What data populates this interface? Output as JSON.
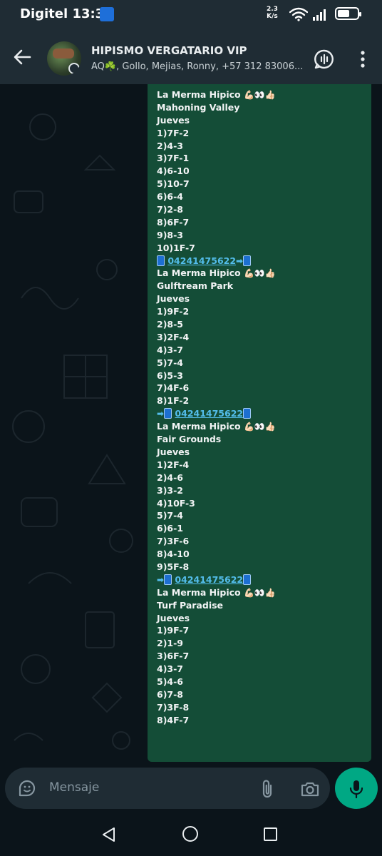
{
  "status_bar": {
    "carrier": "Digitel",
    "time": "13:36",
    "net_speed_value": "2.3",
    "net_speed_unit": "K/s",
    "battery_level": 0.6
  },
  "header": {
    "title": "HIPISMO VERGATARIO VIP",
    "subtitle": "AQ☘️, Gollo, Mejias, Ronny, +57 312 83006..."
  },
  "message": {
    "lines": [
      {
        "text": "La Merma Hipico ",
        "emoji": "💪🏻👀👍🏻"
      },
      {
        "text": "Mahoning Valley"
      },
      {
        "text": "Jueves"
      },
      {
        "text": "1)7F-2"
      },
      {
        "text": "2)4-3"
      },
      {
        "text": "3)7F-1"
      },
      {
        "text": "4)6-10"
      },
      {
        "text": "5)10-7"
      },
      {
        "text": "6)6-4"
      },
      {
        "text": "7)2-8"
      },
      {
        "text": "8)6F-7"
      },
      {
        "text": "9)8-3"
      },
      {
        "text": "10)1F-7"
      },
      {
        "phone": "04241475622",
        "prefix_arrow": "",
        "suffix_arrow": "➡"
      },
      {
        "text": "La Merma Hipico ",
        "emoji": "💪🏻👀👍🏻"
      },
      {
        "text": "Gulftream Park"
      },
      {
        "text": "Jueves"
      },
      {
        "text": "1)9F-2"
      },
      {
        "text": "2)8-5"
      },
      {
        "text": "3)2F-4"
      },
      {
        "text": "4)3-7"
      },
      {
        "text": "5)7-4"
      },
      {
        "text": "6)5-3"
      },
      {
        "text": "7)4F-6"
      },
      {
        "text": "8)1F-2"
      },
      {
        "phone": "04241475622",
        "prefix_arrow": "➡",
        "suffix_arrow": ""
      },
      {
        "text": "La Merma Hipico ",
        "emoji": "💪🏻👀👍🏻"
      },
      {
        "text": "Fair Grounds"
      },
      {
        "text": "Jueves"
      },
      {
        "text": "1)2F-4"
      },
      {
        "text": "2)4-6"
      },
      {
        "text": "3)3-2"
      },
      {
        "text": "4)10F-3"
      },
      {
        "text": "5)7-4"
      },
      {
        "text": "6)6-1"
      },
      {
        "text": "7)3F-6"
      },
      {
        "text": "8)4-10"
      },
      {
        "text": "9)5F-8"
      },
      {
        "phone": "04241475622",
        "prefix_arrow": "➡",
        "suffix_arrow": ""
      },
      {
        "text": "La Merma Hipico ",
        "emoji": "💪🏻👀👍🏻"
      },
      {
        "text": "Turf Paradise"
      },
      {
        "text": "Jueves"
      },
      {
        "text": "1)9F-7"
      },
      {
        "text": "2)1-9"
      },
      {
        "text": "3)6F-7"
      },
      {
        "text": "4)3-7"
      },
      {
        "text": "5)4-6"
      },
      {
        "text": "6)7-8"
      },
      {
        "text": "7)3F-8"
      },
      {
        "text": "8)4F-7"
      }
    ]
  },
  "input": {
    "placeholder": "Mensaje"
  },
  "colors": {
    "bubble": "#144d37",
    "accent": "#00a884",
    "link": "#53bdeb",
    "header": "#1f2c34",
    "background": "#0b141a"
  },
  "icons": [
    "back-arrow-icon",
    "avatar",
    "voice-chat-icon",
    "more-vert-icon",
    "phone-device-icon",
    "sticker-icon",
    "attach-clip-icon",
    "camera-icon",
    "mic-icon",
    "nav-back-icon",
    "nav-home-icon",
    "nav-recents-icon"
  ]
}
